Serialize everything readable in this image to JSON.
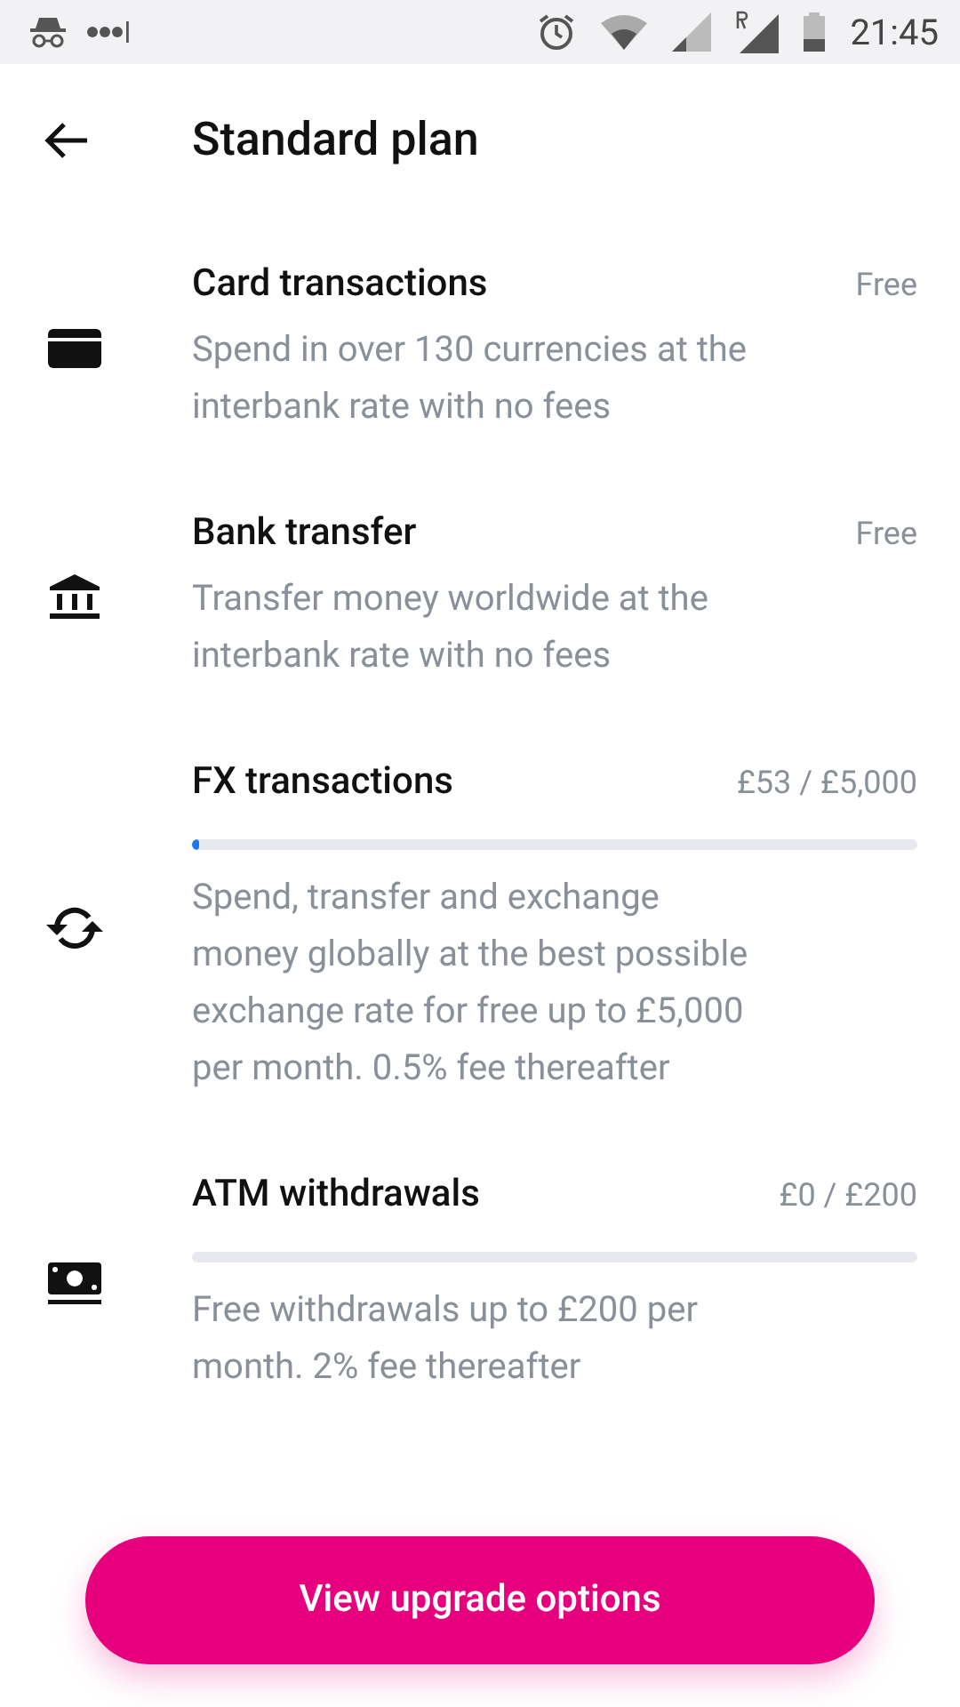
{
  "status_bar": {
    "time": "21:45"
  },
  "header": {
    "title": "Standard plan"
  },
  "features": [
    {
      "kind": "plain",
      "title": "Card transactions",
      "value": "Free",
      "description": "Spend in over 130 currencies at the interbank rate with no fees"
    },
    {
      "kind": "plain",
      "title": "Bank transfer",
      "value": "Free",
      "description": "Transfer money worldwide at the interbank rate with no fees"
    },
    {
      "kind": "meter",
      "title": "FX transactions",
      "value": "£53 / £5,000",
      "level": 0.0106,
      "description": "Spend, transfer and exchange money globally at the best possible exchange rate for free up to £5,000 per month. 0.5% fee thereafter"
    },
    {
      "kind": "meter",
      "title": "ATM withdrawals",
      "value": "£0 / £200",
      "description": "Free withdrawals up to £200 per month. 2% fee thereafter"
    }
  ],
  "button": {
    "label": "View upgrade options"
  }
}
